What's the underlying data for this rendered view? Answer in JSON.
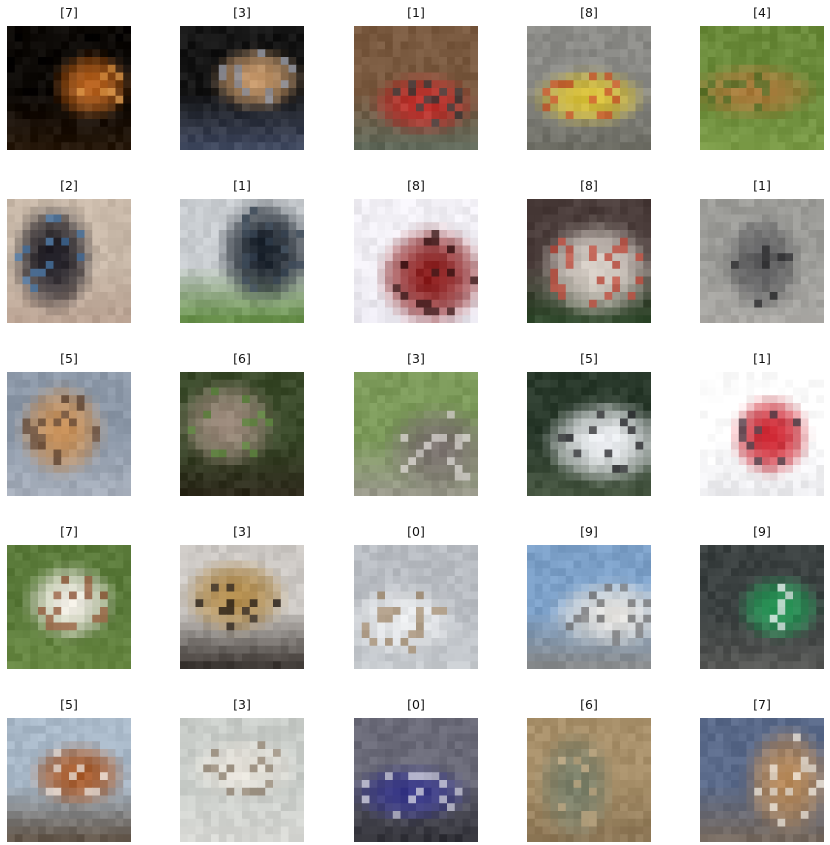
{
  "figure": {
    "rows": 5,
    "cols": 5,
    "cells": [
      {
        "label": "[7]",
        "icon": "horse-photo",
        "palette": {
          "bg": "#0b0805",
          "main": "#b8621e",
          "accent": "#e09a4a",
          "ground": "#2a1a0c"
        }
      },
      {
        "label": "[3]",
        "icon": "cat-photo",
        "palette": {
          "bg": "#151515",
          "main": "#c89a6c",
          "accent": "#8a94a8",
          "ground": "#46506a"
        }
      },
      {
        "label": "[1]",
        "icon": "automobile-photo",
        "palette": {
          "bg": "#7a5a40",
          "main": "#c0302c",
          "accent": "#2c3c3c",
          "ground": "#5c6a5c"
        }
      },
      {
        "label": "[8]",
        "icon": "boat-photo",
        "palette": {
          "bg": "#8a8a86",
          "main": "#d8c038",
          "accent": "#c84a28",
          "ground": "#6a6a60"
        }
      },
      {
        "label": "[4]",
        "icon": "deer-photo",
        "palette": {
          "bg": "#6a8a3a",
          "main": "#a87a3a",
          "accent": "#4a6a24",
          "ground": "#7c9c48"
        }
      },
      {
        "label": "[2]",
        "icon": "bird-photo",
        "palette": {
          "bg": "#c8b8a8",
          "main": "#1c1a22",
          "accent": "#4a7cb0",
          "ground": "#b8a090"
        }
      },
      {
        "label": "[1]",
        "icon": "automobile-photo",
        "palette": {
          "bg": "#c8ccd0",
          "main": "#18202a",
          "accent": "#3c4a5a",
          "ground": "#5c8a3a"
        }
      },
      {
        "label": "[8]",
        "icon": "ship-photo",
        "palette": {
          "bg": "#f0eef4",
          "main": "#8a1c1c",
          "accent": "#2a0c0c",
          "ground": "#e8e6ee"
        }
      },
      {
        "label": "[8]",
        "icon": "ship-photo",
        "palette": {
          "bg": "#4a3c3a",
          "main": "#d8d0c8",
          "accent": "#c04030",
          "ground": "#2c4a2a"
        }
      },
      {
        "label": "[1]",
        "icon": "automobile-photo",
        "palette": {
          "bg": "#9c9c98",
          "main": "#5c5c5e",
          "accent": "#2a2a2c",
          "ground": "#acaaa6"
        }
      },
      {
        "label": "[5]",
        "icon": "dog-photo",
        "palette": {
          "bg": "#8c98a8",
          "main": "#c89058",
          "accent": "#5a4030",
          "ground": "#a8b0bc"
        }
      },
      {
        "label": "[6]",
        "icon": "frog-photo",
        "palette": {
          "bg": "#3a4a2a",
          "main": "#9c8a7c",
          "accent": "#5a8a3a",
          "ground": "#2a2418"
        }
      },
      {
        "label": "[3]",
        "icon": "cat-photo",
        "palette": {
          "bg": "#7c9a5a",
          "main": "#7c7470",
          "accent": "#e0dcd8",
          "ground": "#9c9890"
        }
      },
      {
        "label": "[5]",
        "icon": "dog-photo",
        "palette": {
          "bg": "#2a3a2c",
          "main": "#eef0f4",
          "accent": "#1a1a1e",
          "ground": "#4a5a44"
        }
      },
      {
        "label": "[1]",
        "icon": "automobile-photo",
        "palette": {
          "bg": "#ffffff",
          "main": "#c8202c",
          "accent": "#3a3a44",
          "ground": "#e8e8ec"
        }
      },
      {
        "label": "[7]",
        "icon": "horse-photo",
        "palette": {
          "bg": "#5a7a3a",
          "main": "#f0ece4",
          "accent": "#8a4a2a",
          "ground": "#6a8a44"
        }
      },
      {
        "label": "[3]",
        "icon": "cat-photo",
        "palette": {
          "bg": "#ccc8c4",
          "main": "#b08a4a",
          "accent": "#1a1412",
          "ground": "#2a2420"
        }
      },
      {
        "label": "[0]",
        "icon": "airplane-photo",
        "palette": {
          "bg": "#b8bcc2",
          "main": "#e8eaec",
          "accent": "#9a8060",
          "ground": "#c8ccd0"
        }
      },
      {
        "label": "[9]",
        "icon": "truck-photo",
        "palette": {
          "bg": "#7ca0c8",
          "main": "#e4e2de",
          "accent": "#6a6a6c",
          "ground": "#8a8884"
        }
      },
      {
        "label": "[9]",
        "icon": "truck-photo",
        "palette": {
          "bg": "#3a4040",
          "main": "#2a9a5a",
          "accent": "#f4f2f8",
          "ground": "#5a5a58"
        }
      },
      {
        "label": "[5]",
        "icon": "dog-photo",
        "palette": {
          "bg": "#a8b8c8",
          "main": "#a85a2a",
          "accent": "#f0ece8",
          "ground": "#5a4a3a"
        }
      },
      {
        "label": "[3]",
        "icon": "cat-photo",
        "palette": {
          "bg": "#c8ccc8",
          "main": "#e8e4dc",
          "accent": "#8a7a68",
          "ground": "#d8d8d4"
        }
      },
      {
        "label": "[0]",
        "icon": "airplane-photo",
        "palette": {
          "bg": "#6a6a78",
          "main": "#3a3a8a",
          "accent": "#d8d8e0",
          "ground": "#2a2a30"
        }
      },
      {
        "label": "[6]",
        "icon": "frog-photo",
        "palette": {
          "bg": "#a8906a",
          "main": "#7a806a",
          "accent": "#c8b08a",
          "ground": "#8a7454"
        }
      },
      {
        "label": "[7]",
        "icon": "horse-photo",
        "palette": {
          "bg": "#5a6a8a",
          "main": "#b88a5a",
          "accent": "#f0ece4",
          "ground": "#7a6a5a"
        }
      }
    ]
  }
}
